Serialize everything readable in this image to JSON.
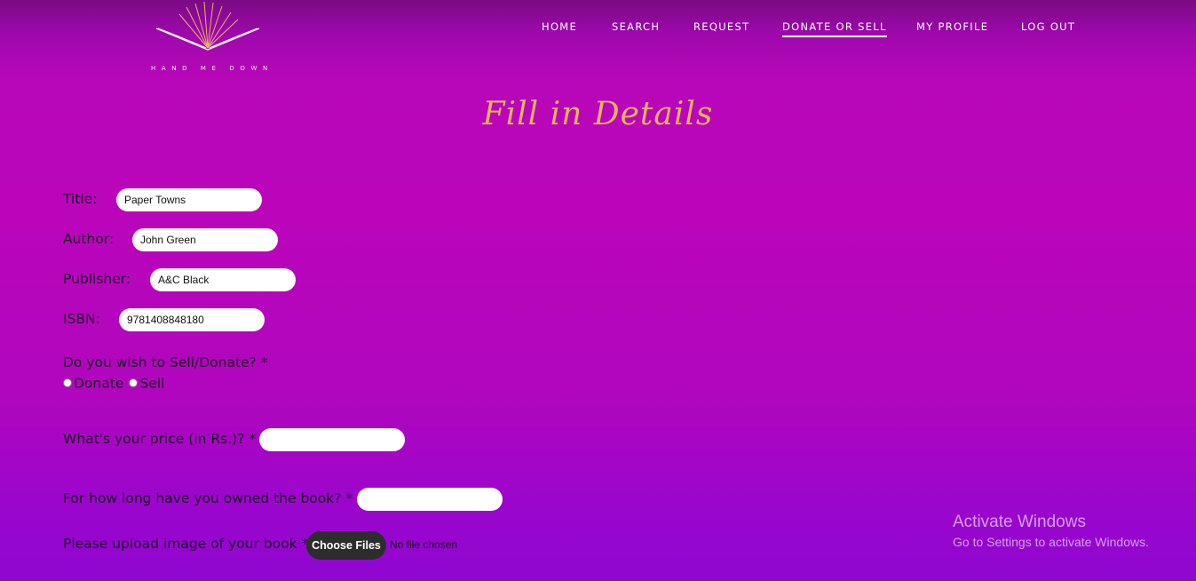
{
  "brand": {
    "logo_text": "HAND ME DOWN",
    "icon": "open-book-sunburst-logo"
  },
  "nav": {
    "items": [
      {
        "label": "HOME"
      },
      {
        "label": "SEARCH"
      },
      {
        "label": "REQUEST"
      },
      {
        "label": "DONATE OR SELL",
        "active": true
      },
      {
        "label": "MY PROFILE"
      },
      {
        "label": "LOG OUT"
      }
    ]
  },
  "page": {
    "title": "Fill in Details"
  },
  "form": {
    "title_label": "Title:",
    "title_value": "Paper Towns",
    "author_label": "Author:",
    "author_value": "John Green",
    "publisher_label": "Publisher:",
    "publisher_value": "A&C Black",
    "isbn_label": "ISBN:",
    "isbn_value": "9781408848180",
    "sell_donate_question": "Do you wish to Sell/Donate? *",
    "option_donate": "Donate",
    "option_sell": "Sell",
    "price_label": "What's your price (in Rs.)? *",
    "price_value": "",
    "owned_label": "For how long have you owned the book? *",
    "owned_value": "",
    "upload_label": "Please upload image of your book *",
    "upload_button": "Choose Files",
    "upload_status": "No file chosen"
  },
  "watermark": {
    "title": "Activate Windows",
    "subtitle": "Go to Settings to activate Windows."
  },
  "colors": {
    "background_top": "#7a0a86",
    "background_main": "#bb05bb",
    "background_bottom": "#8f07d0",
    "title_gold": "#e8b25f",
    "file_button": "#2d2d2d"
  }
}
